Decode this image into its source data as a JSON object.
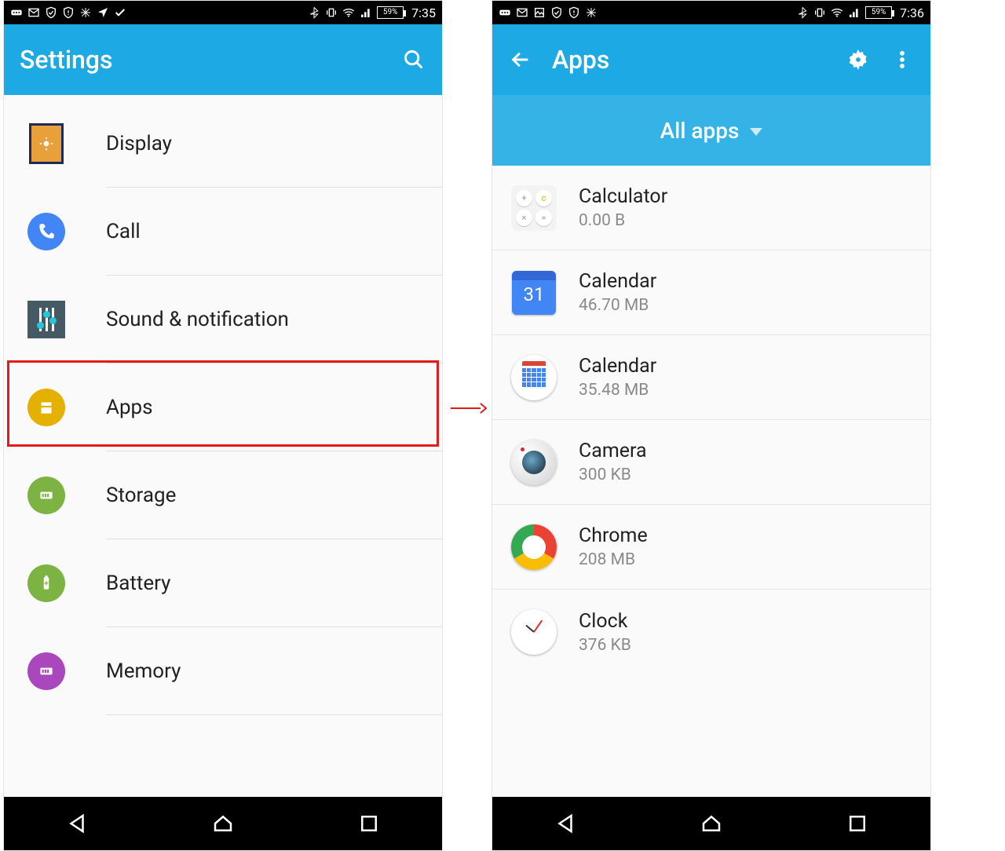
{
  "left": {
    "status": {
      "battery": "59%",
      "time": "7:35"
    },
    "appbar": {
      "title": "Settings"
    },
    "items": [
      {
        "key": "display",
        "label": "Display"
      },
      {
        "key": "call",
        "label": "Call"
      },
      {
        "key": "sound",
        "label": "Sound & notification"
      },
      {
        "key": "apps",
        "label": "Apps"
      },
      {
        "key": "storage",
        "label": "Storage"
      },
      {
        "key": "battery",
        "label": "Battery"
      },
      {
        "key": "memory",
        "label": "Memory"
      }
    ]
  },
  "right": {
    "status": {
      "battery": "59%",
      "time": "7:36"
    },
    "appbar": {
      "title": "Apps"
    },
    "subbar": {
      "label": "All apps"
    },
    "gcal_day": "31",
    "apps": [
      {
        "key": "calculator",
        "name": "Calculator",
        "size": "0.00 B"
      },
      {
        "key": "gcalendar",
        "name": "Calendar",
        "size": "46.70 MB"
      },
      {
        "key": "stockcalendar",
        "name": "Calendar",
        "size": "35.48 MB"
      },
      {
        "key": "camera",
        "name": "Camera",
        "size": "300 KB"
      },
      {
        "key": "chrome",
        "name": "Chrome",
        "size": "208 MB"
      },
      {
        "key": "clock",
        "name": "Clock",
        "size": "376 KB"
      }
    ]
  }
}
